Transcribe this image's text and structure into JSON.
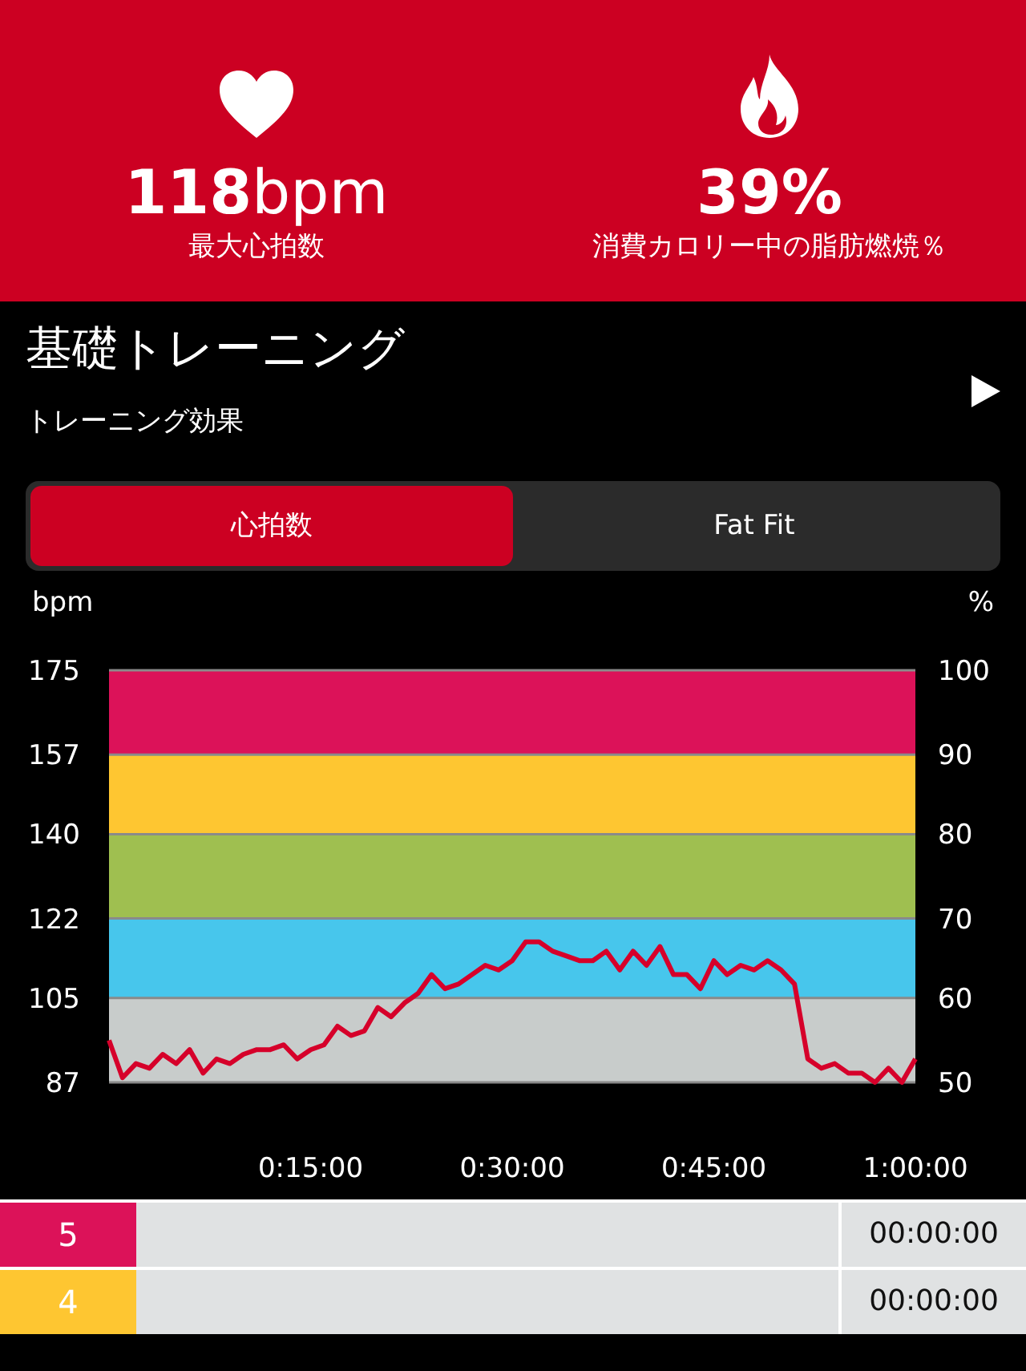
{
  "summary": [
    {
      "value": "**118**bpm",
      "label": "最大心拍数"
    },
    {
      "value": "39%",
      "label": "消費カロリー中の脂肪燃焼％"
    }
  ],
  "workout": {
    "title": "基礎トレーニング",
    "subtitle": "トレーニング効果"
  },
  "tabs": [
    {
      "label": "心拍数",
      "selected": true
    },
    {
      "label": "Fat Fit",
      "selected": false
    }
  ],
  "chart": {
    "right_axis_title": "%",
    "right_ticks": [
      "100",
      "90",
      "80",
      "70",
      "60",
      "50"
    ],
    "chart_data": {
      "type": "line",
      "ylabel": "bpm",
      "xlim": [
        0,
        60
      ],
      "ylim": [
        87,
        175
      ],
      "xticks": [
        {
          "value": 15,
          "label": "0:15:00"
        },
        {
          "value": 30,
          "label": "0:30:00"
        },
        {
          "value": 45,
          "label": "0:45:00"
        },
        {
          "value": 60,
          "label": "1:00:00"
        }
      ],
      "yticks": [
        175,
        157,
        140,
        122,
        105,
        87
      ],
      "grid": true,
      "bands": [
        {
          "axis": "y",
          "from": 157,
          "to": 175,
          "color": "#dc1259"
        },
        {
          "axis": "y",
          "from": 140,
          "to": 157,
          "color": "#fec631"
        },
        {
          "axis": "y",
          "from": 122,
          "to": 140,
          "color": "#9fbf50"
        },
        {
          "axis": "y",
          "from": 105,
          "to": 122,
          "color": "#47c6ec"
        },
        {
          "axis": "y",
          "from": 87,
          "to": 105,
          "color": "#c8cccb"
        }
      ],
      "x": [
        0,
        1,
        2,
        3,
        4,
        5,
        6,
        7,
        8,
        9,
        10,
        11,
        12,
        13,
        14,
        15,
        16,
        17,
        18,
        19,
        20,
        21,
        22,
        23,
        24,
        25,
        26,
        27,
        28,
        29,
        30,
        31,
        32,
        33,
        34,
        35,
        36,
        37,
        38,
        39,
        40,
        41,
        42,
        43,
        44,
        45,
        46,
        47,
        48,
        49,
        50,
        51,
        52,
        53,
        54,
        55,
        56,
        57,
        58,
        59,
        60
      ],
      "series": [
        {
          "color": "#d6002a",
          "values": [
            96,
            88,
            91,
            90,
            93,
            91,
            94,
            89,
            92,
            91,
            93,
            94,
            94,
            95,
            92,
            94,
            95,
            99,
            97,
            98,
            103,
            101,
            104,
            106,
            110,
            107,
            108,
            110,
            112,
            111,
            113,
            117,
            117,
            115,
            114,
            113,
            113,
            115,
            111,
            115,
            112,
            116,
            110,
            110,
            107,
            113,
            110,
            112,
            111,
            113,
            111,
            108,
            92,
            90,
            91,
            89,
            89,
            87,
            90,
            87,
            92
          ]
        }
      ]
    }
  },
  "zones": [
    {
      "zone": "5",
      "color": "#dc1259",
      "time": "00:00:00"
    },
    {
      "zone": "4",
      "color": "#fec631",
      "time": "00:00:00"
    }
  ]
}
